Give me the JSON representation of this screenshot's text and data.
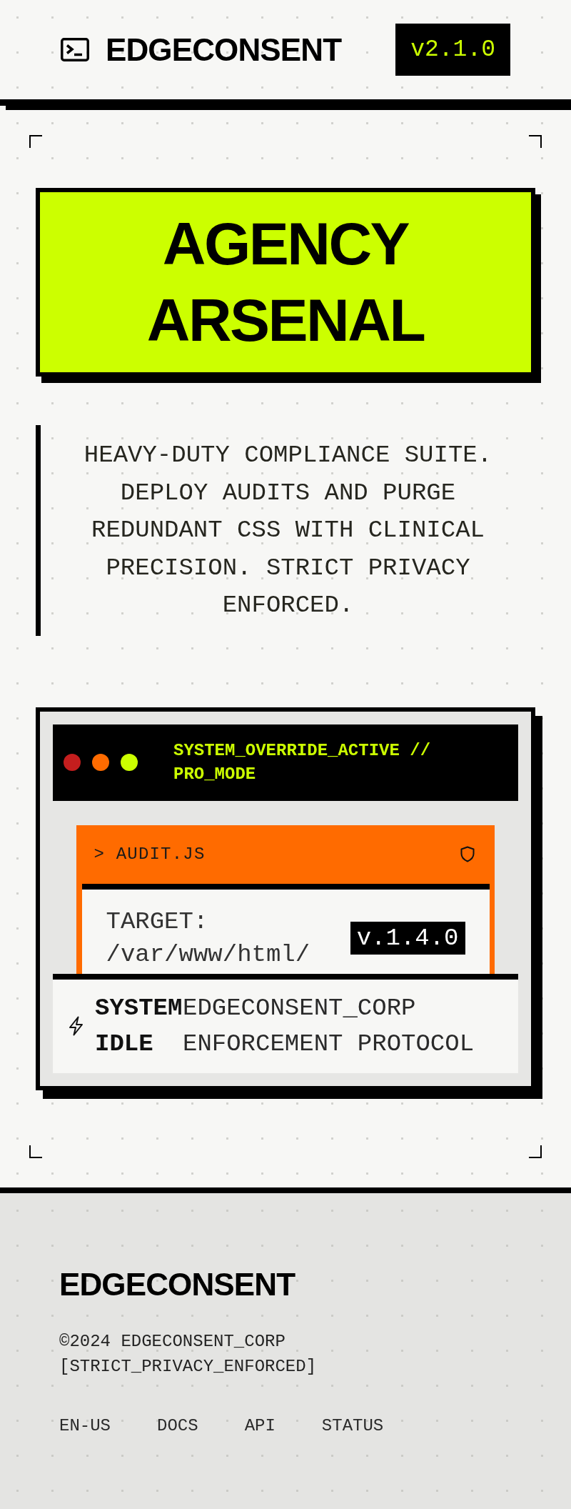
{
  "header": {
    "logo": "EDGECONSENT",
    "version": "v2.1.0"
  },
  "hero": {
    "title": "AGENCY ARSENAL"
  },
  "description": "HEAVY-DUTY COMPLIANCE SUITE. DEPLOY AUDITS AND PURGE REDUNDANT CSS WITH CLINICAL PRECISION. STRICT PRIVACY ENFORCED.",
  "terminal": {
    "window_dots": [
      {
        "color": "#c41e1e"
      },
      {
        "color": "#ff6b00"
      },
      {
        "color": "#ccff00"
      }
    ],
    "title": "SYSTEM_OVERRIDE_ACTIVE // PRO_MODE",
    "file_panel": {
      "name": "> AUDIT.JS",
      "target": "TARGET: /var/www/html/",
      "version": "v.1.4.0"
    },
    "status": {
      "label": "SYSTEM IDLE",
      "text": "EDGECONSENT_CORP ENFORCEMENT PROTOCOL"
    }
  },
  "footer": {
    "brand": "EDGECONSENT",
    "copyright": "©2024 EDGECONSENT_CORP [STRICT_PRIVACY_ENFORCED]",
    "links": [
      "EN-US",
      "DOCS",
      "API",
      "STATUS"
    ]
  }
}
